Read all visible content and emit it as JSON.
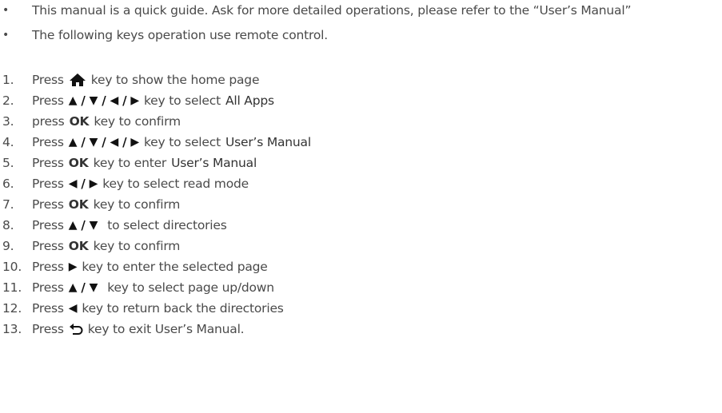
{
  "notes": [
    "This manual is a quick guide. Ask for more detailed operations, please refer to the “User’s Manual”",
    "The following keys operation use remote control."
  ],
  "bullet_char": "•",
  "icons": {
    "home": "home-icon",
    "up": "▲",
    "down": "▼",
    "left": "◀",
    "right": "▶",
    "slash": "/",
    "back": "back-arrow-icon"
  },
  "steps": [
    {
      "num": "1.",
      "press": "Press",
      "rest": "key to show the home page"
    },
    {
      "num": "2.",
      "press": "Press",
      "rest": "key to select",
      "target": "All Apps"
    },
    {
      "num": "3.",
      "press": "press",
      "key": "OK",
      "rest": "key to confirm"
    },
    {
      "num": "4.",
      "press": "Press",
      "rest": "key to select",
      "target": "User’s Manual"
    },
    {
      "num": "5.",
      "press": "Press",
      "key": "OK",
      "rest": "key to enter",
      "target": "User’s Manual"
    },
    {
      "num": "6.",
      "press": "Press",
      "rest": "key to select read mode"
    },
    {
      "num": "7.",
      "press": "Press",
      "key": "OK",
      "rest": "key to confirm"
    },
    {
      "num": "8.",
      "press": "Press",
      "rest": "to select directories"
    },
    {
      "num": "9.",
      "press": "Press",
      "key": "OK",
      "rest": "key to confirm"
    },
    {
      "num": "10.",
      "press": "Press",
      "rest": "key to enter the selected page"
    },
    {
      "num": "11.",
      "press": "Press",
      "rest": "key to select page up/down"
    },
    {
      "num": "12.",
      "press": "Press",
      "rest": "key to return back the directories"
    },
    {
      "num": "13.",
      "press": "Press",
      "rest": "key to exit User’s Manual."
    }
  ]
}
